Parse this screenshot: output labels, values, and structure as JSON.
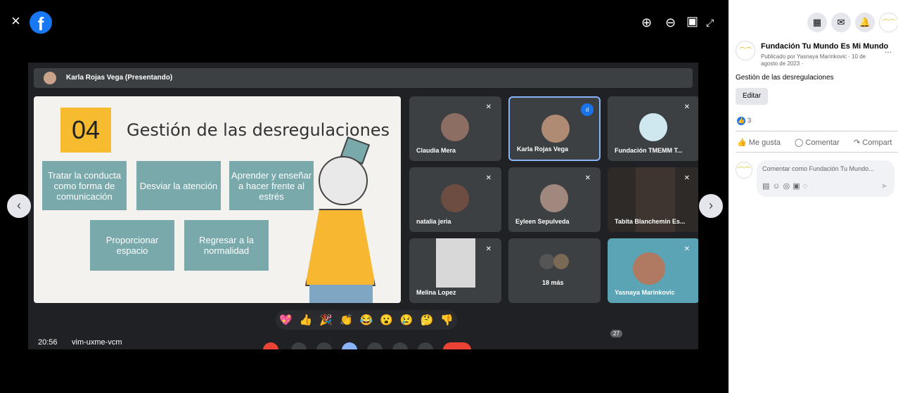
{
  "viewer": {
    "close_icon": "×",
    "zoom_in_icon": "⊕",
    "zoom_out_icon": "⊖",
    "tag_icon": "▣",
    "fullscreen_icon": "⤢",
    "prev_icon": "‹",
    "next_icon": "›"
  },
  "meet": {
    "presenter_label": "Karla Rojas Vega (Presentando)",
    "time": "20:56",
    "meeting_code": "vim-uxme-vcm",
    "participant_badge": "27",
    "reactions": [
      "💖",
      "👍",
      "🎉",
      "👏",
      "😂",
      "😮",
      "😢",
      "🤔",
      "👎"
    ]
  },
  "slide": {
    "number": "04",
    "title": "Gestión de las desregulaciones",
    "boxes": [
      "Tratar la conducta como forma de comunicación",
      "Desviar la atención",
      "Aprender y enseñar a hacer frente al estrés",
      "Proporcionar espacio",
      "Regresar a la normalidad"
    ]
  },
  "participants": [
    {
      "name": "Claudia Mera"
    },
    {
      "name": "Karla Rojas Vega"
    },
    {
      "name": "Fundación TMEMM T..."
    },
    {
      "name": "natalia jeria"
    },
    {
      "name": "Eyleen Sepulveda"
    },
    {
      "name": "Tabita Blanchemin Es..."
    },
    {
      "name": "Melina Lopez"
    },
    {
      "name": "18 más"
    },
    {
      "name": "Yasnaya Marinkovic"
    }
  ],
  "post": {
    "page_name": "Fundación Tu Mundo Es Mi Mundo",
    "meta": "Publicado por Yasnaya Marinkovic · 10 de agosto de 2023 ·",
    "text": "Gestión de las desregulaciones",
    "edit_label": "Editar",
    "like_count": "3",
    "actions": {
      "like": "Me gusta",
      "comment": "Comentar",
      "share": "Compart"
    },
    "comment_placeholder": "Comentar como Fundación Tu Mundo...",
    "more_icon": "..."
  },
  "colors": {
    "facebook_blue": "#1877f2",
    "meet_bg": "#202124",
    "tile_bg": "#3c4043",
    "slide_accent": "#f6bb2f",
    "box_teal": "#79a9ab"
  }
}
